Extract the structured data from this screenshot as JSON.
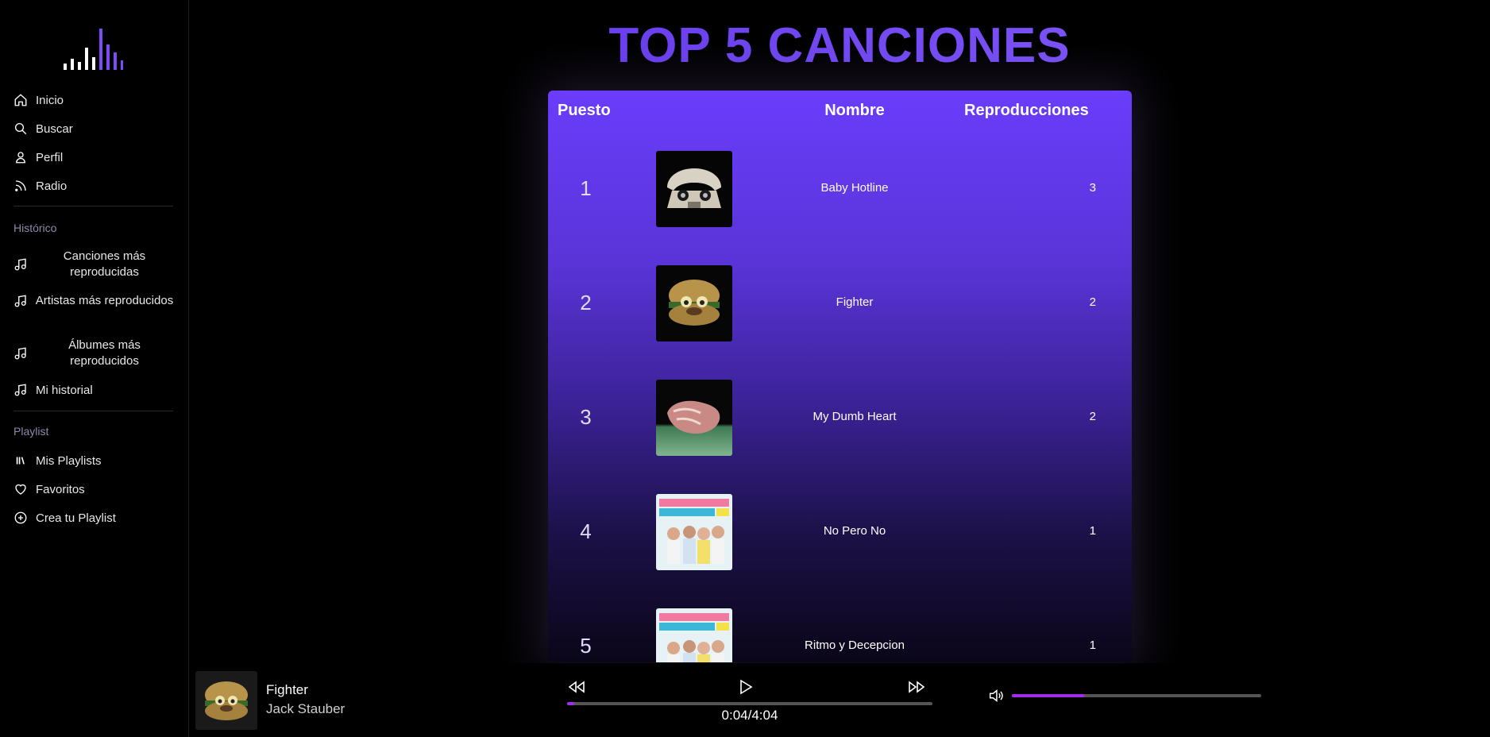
{
  "sidebar": {
    "nav": [
      {
        "label": "Inicio",
        "icon": "home-icon"
      },
      {
        "label": "Buscar",
        "icon": "search-icon"
      },
      {
        "label": "Perfil",
        "icon": "user-icon"
      },
      {
        "label": "Radio",
        "icon": "rss-icon"
      }
    ],
    "history_title": "Histórico",
    "history": [
      {
        "label": "Canciones más reproducidas",
        "icon": "music-note-icon"
      },
      {
        "label": "Artistas más reproducidos",
        "icon": "music-note-icon"
      },
      {
        "label": "Álbumes más reproducidos",
        "icon": "music-note-icon"
      },
      {
        "label": "Mi historial",
        "icon": "music-note-icon"
      }
    ],
    "playlist_title": "Playlist",
    "playlists": [
      {
        "label": "Mis Playlists",
        "icon": "library-icon"
      },
      {
        "label": "Favoritos",
        "icon": "heart-icon"
      },
      {
        "label": "Crea tu Playlist",
        "icon": "plus-circle-icon"
      }
    ]
  },
  "main": {
    "title": "TOP 5 CANCIONES",
    "headers": {
      "rank": "Puesto",
      "name": "Nombre",
      "plays": "Reproducciones"
    },
    "rows": [
      {
        "rank": "1",
        "name": "Baby Hotline",
        "plays": "3",
        "cover": "telephone-skull-cover"
      },
      {
        "rank": "2",
        "name": "Fighter",
        "plays": "2",
        "cover": "burger-face-cover"
      },
      {
        "rank": "3",
        "name": "My Dumb Heart",
        "plays": "2",
        "cover": "meat-heart-cover"
      },
      {
        "rank": "4",
        "name": "No Pero No",
        "plays": "1",
        "cover": "band-photo-cover"
      },
      {
        "rank": "5",
        "name": "Ritmo y Decepcion",
        "plays": "1",
        "cover": "band-photo-cover"
      }
    ]
  },
  "player": {
    "title": "Fighter",
    "artist": "Jack Stauber",
    "time": "0:04/4:04",
    "progress": 0.02,
    "volume": 0.29
  },
  "colors": {
    "accent": "#a22bf0",
    "title_gradient_start": "#5b2fe8",
    "title_gradient_end": "#8a63ff",
    "table_top": "#6a3dfb"
  }
}
